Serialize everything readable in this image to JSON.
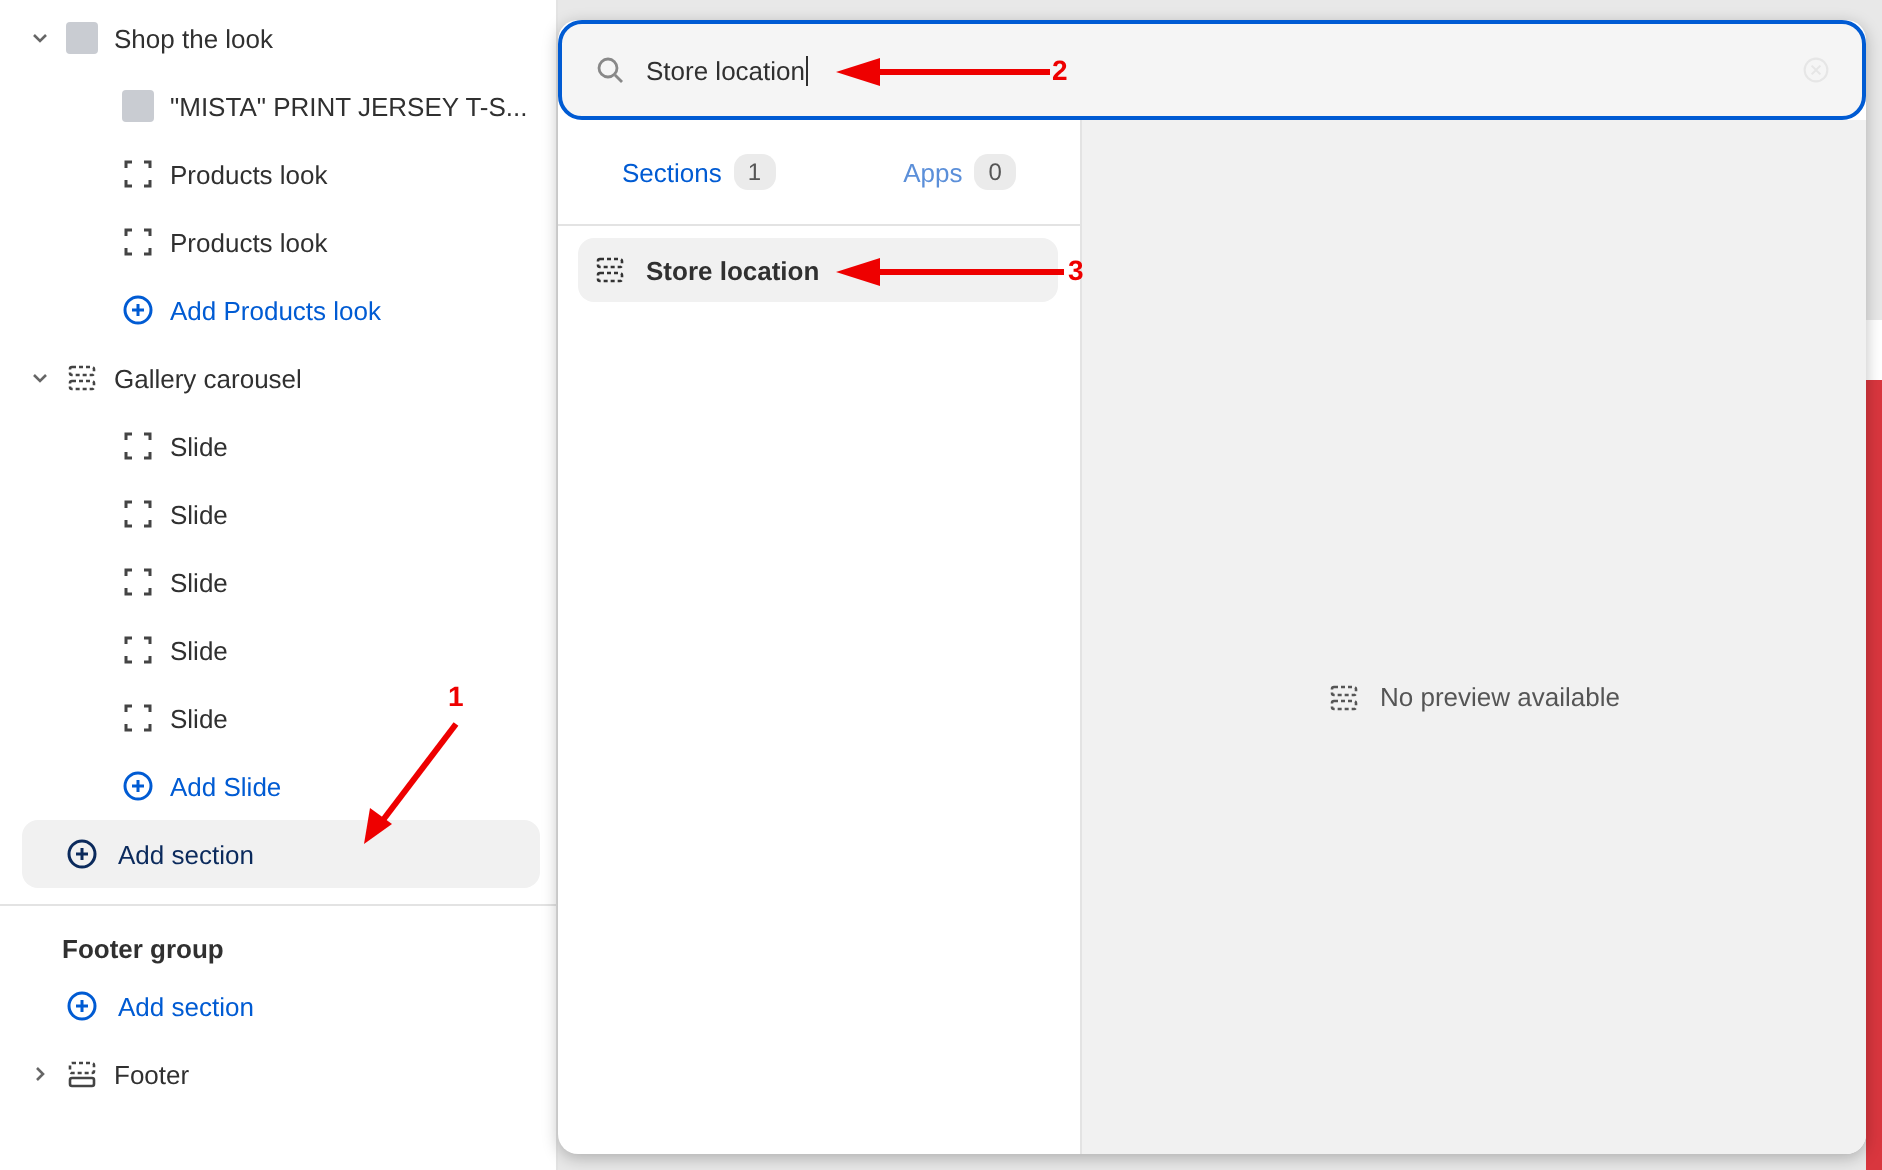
{
  "sidebar": {
    "sections": [
      {
        "label": "Shop the look",
        "expanded": true,
        "kind": "product",
        "children": [
          {
            "kind": "product",
            "label": "\"MISTA\" PRINT JERSEY T-S..."
          },
          {
            "kind": "block",
            "label": "Products look"
          },
          {
            "kind": "block",
            "label": "Products look"
          },
          {
            "kind": "add",
            "label": "Add Products look"
          }
        ]
      },
      {
        "label": "Gallery carousel",
        "expanded": true,
        "kind": "section",
        "children": [
          {
            "kind": "block",
            "label": "Slide"
          },
          {
            "kind": "block",
            "label": "Slide"
          },
          {
            "kind": "block",
            "label": "Slide"
          },
          {
            "kind": "block",
            "label": "Slide"
          },
          {
            "kind": "block",
            "label": "Slide"
          },
          {
            "kind": "add",
            "label": "Add Slide"
          }
        ]
      }
    ],
    "add_section": {
      "label": "Add section",
      "selected": true
    },
    "footer_group": {
      "title": "Footer group",
      "add_section": {
        "label": "Add section",
        "selected": false
      },
      "sections": [
        {
          "label": "Footer",
          "expanded": false,
          "kind": "footer"
        }
      ]
    }
  },
  "search_popup": {
    "query": "Store location",
    "tabs": [
      {
        "label": "Sections",
        "count": "1",
        "selected": true
      },
      {
        "label": "Apps",
        "count": "0",
        "selected": false
      }
    ],
    "results": [
      {
        "label": "Store location",
        "selected": true
      }
    ],
    "preview": {
      "message": "No preview available"
    }
  },
  "annotations": [
    {
      "label": "1"
    },
    {
      "label": "2"
    },
    {
      "label": "3"
    }
  ]
}
